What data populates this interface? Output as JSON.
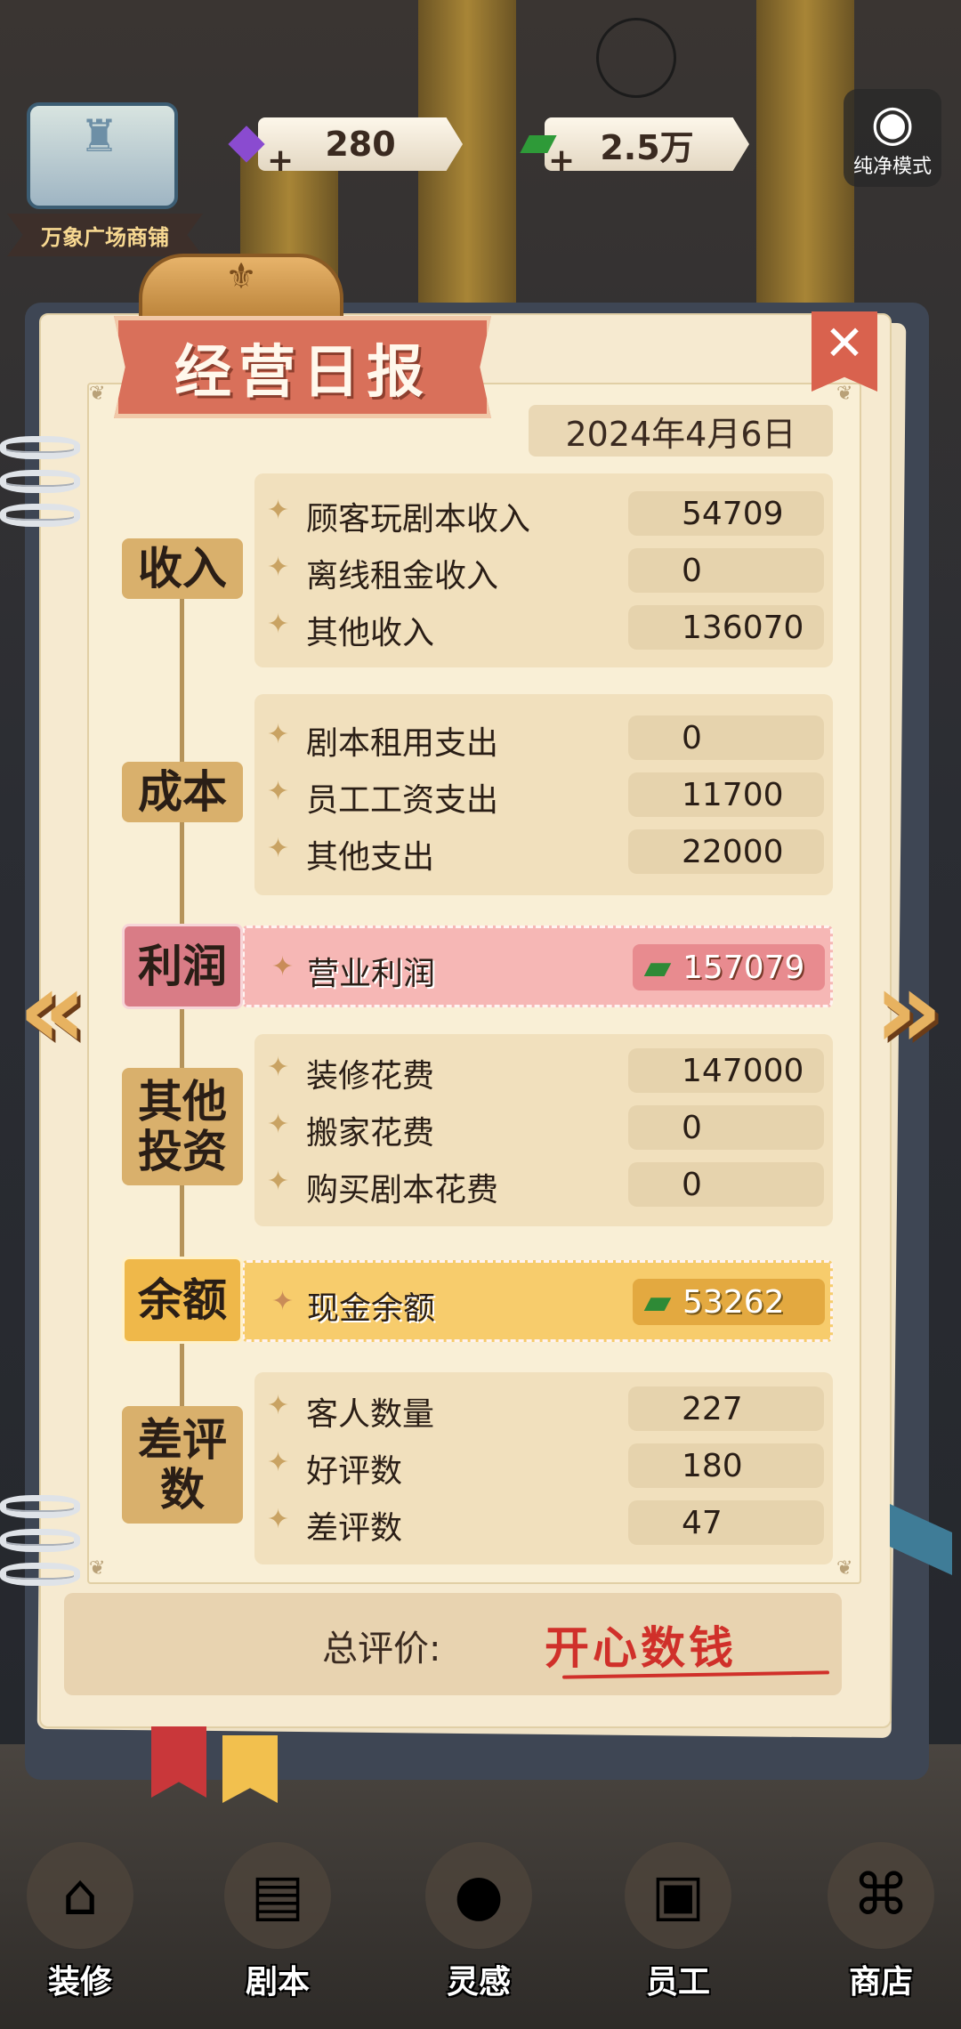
{
  "topbar": {
    "shop_name": "万象广场商铺",
    "gems": "280",
    "cash": "2.5万",
    "pure_mode_label": "纯净模式"
  },
  "report": {
    "title": "经营日报",
    "date": "2024年4月6日",
    "close_symbol": "✕",
    "sections": {
      "income": {
        "tag": "收入",
        "rows": [
          {
            "label": "顾客玩剧本收入",
            "value": "54709"
          },
          {
            "label": "离线租金收入",
            "value": "0"
          },
          {
            "label": "其他收入",
            "value": "136070"
          }
        ]
      },
      "cost": {
        "tag": "成本",
        "rows": [
          {
            "label": "剧本租用支出",
            "value": "0"
          },
          {
            "label": "员工工资支出",
            "value": "11700"
          },
          {
            "label": "其他支出",
            "value": "22000"
          }
        ]
      },
      "profit": {
        "tag": "利润",
        "label": "营业利润",
        "value": "157079"
      },
      "investment": {
        "tag_line1": "其他",
        "tag_line2": "投资",
        "rows": [
          {
            "label": "装修花费",
            "value": "147000"
          },
          {
            "label": "搬家花费",
            "value": "0"
          },
          {
            "label": "购买剧本花费",
            "value": "0"
          }
        ]
      },
      "balance": {
        "tag": "余额",
        "label": "现金余额",
        "value": "53262"
      },
      "reviews": {
        "tag_line1": "差评",
        "tag_line2": "数",
        "rows": [
          {
            "label": "客人数量",
            "value": "227"
          },
          {
            "label": "好评数",
            "value": "180"
          },
          {
            "label": "差评数",
            "value": "47"
          }
        ]
      }
    },
    "summary": {
      "label": "总评价:",
      "value": "开心数钱"
    }
  },
  "bottom_nav": [
    {
      "label": "装修",
      "icon": "house-icon"
    },
    {
      "label": "剧本",
      "icon": "script-book-icon"
    },
    {
      "label": "灵感",
      "icon": "crystal-ball-icon"
    },
    {
      "label": "员工",
      "icon": "id-card-icon"
    },
    {
      "label": "商店",
      "icon": "shop-icon"
    }
  ],
  "colors": {
    "paper": "#f6ead0",
    "title_banner": "#d9705a",
    "profit_row": "#f6b7b5",
    "balance_row": "#f7cc6c",
    "summary_text": "#d0302a"
  }
}
